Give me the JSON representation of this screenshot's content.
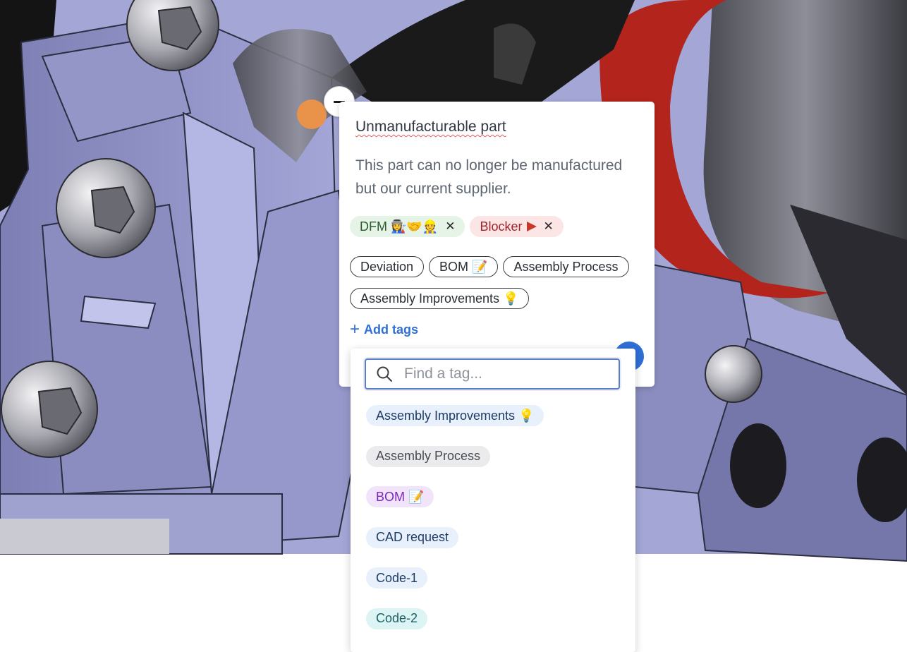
{
  "card": {
    "title": "Unmanufacturable part",
    "body": "This part can no longer be manufactured but our current supplier.",
    "applied_tags": [
      {
        "label": "DFM 👩‍🏭🤝👷",
        "color": "#e6f4e7"
      },
      {
        "label": "Blocker",
        "color": "#fbe5e5"
      }
    ],
    "suggested_tags": [
      "Deviation",
      "BOM 📝",
      "Assembly Process",
      "Assembly Improvements 💡"
    ],
    "add_tags_label": "Add tags"
  },
  "dropdown": {
    "search_placeholder": "Find a tag...",
    "options": [
      {
        "label": "Assembly Improvements 💡",
        "color": "#e7f0fb"
      },
      {
        "label": "Assembly Process",
        "color": "#ebebed"
      },
      {
        "label": "BOM 📝",
        "color": "#f1e4fa"
      },
      {
        "label": "CAD request",
        "color": "#e7f0fb"
      },
      {
        "label": "Code-1",
        "color": "#e7f0fb"
      },
      {
        "label": "Code-2",
        "color": "#dcf4f4"
      }
    ]
  },
  "icons": [
    "minus-icon",
    "close-icon",
    "flag-icon",
    "plus-icon",
    "search-icon"
  ]
}
